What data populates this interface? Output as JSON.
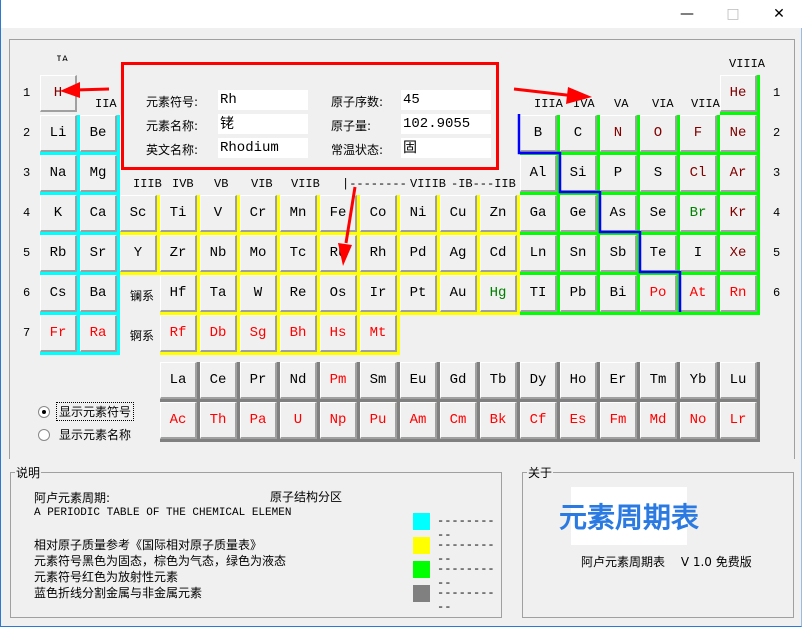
{
  "window": {
    "controls": [
      "minimize",
      "maximize",
      "close"
    ]
  },
  "info": {
    "symbol_label": "元素符号:",
    "symbol": "Rh",
    "name_label": "元素名称:",
    "name": "铑",
    "english_label": "英文名称:",
    "english": "Rhodium",
    "number_label": "原子序数:",
    "number": "45",
    "mass_label": "原子量:",
    "mass": "102.9055",
    "state_label": "常温状态:",
    "state": "固"
  },
  "colors": {
    "solid": "#000000",
    "gas": "#800000",
    "liquid": "#008000",
    "radioactive": "#ff0000",
    "s": "#00ffff",
    "d": "#ffff00",
    "p": "#00ff00",
    "f": "#808080",
    "boundary": "#0000ff",
    "highlight": "#ff0000"
  },
  "group_labels": {
    "IA": "IA",
    "IIA": "IIA",
    "IIIA": "IIIA",
    "IVA": "IVA",
    "VA": "VA",
    "VIA": "VIA",
    "VIIA": "VIIA",
    "VIIIA": "VIIIA",
    "IIIB": "IIIB",
    "IVB": "IVB",
    "VB": "VB",
    "VIB": "VIB",
    "VIIB": "VIIB",
    "VIII_start": "|--------",
    "VIIIB": "VIIIB",
    "IB_IIB": "-IB---IIB"
  },
  "periods": [
    "1",
    "2",
    "3",
    "4",
    "5",
    "6",
    "7"
  ],
  "series_labels": {
    "lanthanide": "镧系",
    "actinide": "锕系"
  },
  "elements": [
    [
      "H",
      1,
      1,
      "gas",
      "none"
    ],
    [
      "He",
      1,
      18,
      "gas",
      "p"
    ],
    [
      "Li",
      2,
      1,
      "solid",
      "s"
    ],
    [
      "Be",
      2,
      2,
      "solid",
      "s"
    ],
    [
      "B",
      2,
      13,
      "solid",
      "p"
    ],
    [
      "C",
      2,
      14,
      "solid",
      "p"
    ],
    [
      "N",
      2,
      15,
      "gas",
      "p"
    ],
    [
      "O",
      2,
      16,
      "gas",
      "p"
    ],
    [
      "F",
      2,
      17,
      "gas",
      "p"
    ],
    [
      "Ne",
      2,
      18,
      "gas",
      "p"
    ],
    [
      "Na",
      3,
      1,
      "solid",
      "s"
    ],
    [
      "Mg",
      3,
      2,
      "solid",
      "s"
    ],
    [
      "Al",
      3,
      13,
      "solid",
      "p"
    ],
    [
      "Si",
      3,
      14,
      "solid",
      "p"
    ],
    [
      "P",
      3,
      15,
      "solid",
      "p"
    ],
    [
      "S",
      3,
      16,
      "solid",
      "p"
    ],
    [
      "Cl",
      3,
      17,
      "gas",
      "p"
    ],
    [
      "Ar",
      3,
      18,
      "gas",
      "p"
    ],
    [
      "K",
      4,
      1,
      "solid",
      "s"
    ],
    [
      "Ca",
      4,
      2,
      "solid",
      "s"
    ],
    [
      "Sc",
      4,
      3,
      "solid",
      "d"
    ],
    [
      "Ti",
      4,
      4,
      "solid",
      "d"
    ],
    [
      "V",
      4,
      5,
      "solid",
      "d"
    ],
    [
      "Cr",
      4,
      6,
      "solid",
      "d"
    ],
    [
      "Mn",
      4,
      7,
      "solid",
      "d"
    ],
    [
      "Fe",
      4,
      8,
      "solid",
      "d"
    ],
    [
      "Co",
      4,
      9,
      "solid",
      "d"
    ],
    [
      "Ni",
      4,
      10,
      "solid",
      "d"
    ],
    [
      "Cu",
      4,
      11,
      "solid",
      "d"
    ],
    [
      "Zn",
      4,
      12,
      "solid",
      "d"
    ],
    [
      "Ga",
      4,
      13,
      "solid",
      "p"
    ],
    [
      "Ge",
      4,
      14,
      "solid",
      "p"
    ],
    [
      "As",
      4,
      15,
      "solid",
      "p"
    ],
    [
      "Se",
      4,
      16,
      "solid",
      "p"
    ],
    [
      "Br",
      4,
      17,
      "liquid",
      "p"
    ],
    [
      "Kr",
      4,
      18,
      "gas",
      "p"
    ],
    [
      "Rb",
      5,
      1,
      "solid",
      "s"
    ],
    [
      "Sr",
      5,
      2,
      "solid",
      "s"
    ],
    [
      "Y",
      5,
      3,
      "solid",
      "d"
    ],
    [
      "Zr",
      5,
      4,
      "solid",
      "d"
    ],
    [
      "Nb",
      5,
      5,
      "solid",
      "d"
    ],
    [
      "Mo",
      5,
      6,
      "solid",
      "d"
    ],
    [
      "Tc",
      5,
      7,
      "solid",
      "d"
    ],
    [
      "Ru",
      5,
      8,
      "solid",
      "d"
    ],
    [
      "Rh",
      5,
      9,
      "solid",
      "d"
    ],
    [
      "Pd",
      5,
      10,
      "solid",
      "d"
    ],
    [
      "Ag",
      5,
      11,
      "solid",
      "d"
    ],
    [
      "Cd",
      5,
      12,
      "solid",
      "d"
    ],
    [
      "Ln",
      5,
      13,
      "solid",
      "p"
    ],
    [
      "Sn",
      5,
      14,
      "solid",
      "p"
    ],
    [
      "Sb",
      5,
      15,
      "solid",
      "p"
    ],
    [
      "Te",
      5,
      16,
      "solid",
      "p"
    ],
    [
      "I",
      5,
      17,
      "solid",
      "p"
    ],
    [
      "Xe",
      5,
      18,
      "gas",
      "p"
    ],
    [
      "Cs",
      6,
      1,
      "solid",
      "s"
    ],
    [
      "Ba",
      6,
      2,
      "solid",
      "s"
    ],
    [
      "Hf",
      6,
      4,
      "solid",
      "d"
    ],
    [
      "Ta",
      6,
      5,
      "solid",
      "d"
    ],
    [
      "W",
      6,
      6,
      "solid",
      "d"
    ],
    [
      "Re",
      6,
      7,
      "solid",
      "d"
    ],
    [
      "Os",
      6,
      8,
      "solid",
      "d"
    ],
    [
      "Ir",
      6,
      9,
      "solid",
      "d"
    ],
    [
      "Pt",
      6,
      10,
      "solid",
      "d"
    ],
    [
      "Au",
      6,
      11,
      "solid",
      "d"
    ],
    [
      "Hg",
      6,
      12,
      "liquid",
      "d"
    ],
    [
      "TI",
      6,
      13,
      "solid",
      "p"
    ],
    [
      "Pb",
      6,
      14,
      "solid",
      "p"
    ],
    [
      "Bi",
      6,
      15,
      "solid",
      "p"
    ],
    [
      "Po",
      6,
      16,
      "radioactive",
      "p"
    ],
    [
      "At",
      6,
      17,
      "radioactive",
      "p"
    ],
    [
      "Rn",
      6,
      18,
      "radioactive",
      "p"
    ],
    [
      "Fr",
      7,
      1,
      "radioactive",
      "s"
    ],
    [
      "Ra",
      7,
      2,
      "radioactive",
      "s"
    ],
    [
      "Rf",
      7,
      4,
      "radioactive",
      "d"
    ],
    [
      "Db",
      7,
      5,
      "radioactive",
      "d"
    ],
    [
      "Sg",
      7,
      6,
      "radioactive",
      "d"
    ],
    [
      "Bh",
      7,
      7,
      "radioactive",
      "d"
    ],
    [
      "Hs",
      7,
      8,
      "radioactive",
      "d"
    ],
    [
      "Mt",
      7,
      9,
      "radioactive",
      "d"
    ]
  ],
  "lanthanides": [
    [
      "La",
      "solid"
    ],
    [
      "Ce",
      "solid"
    ],
    [
      "Pr",
      "solid"
    ],
    [
      "Nd",
      "solid"
    ],
    [
      "Pm",
      "radioactive"
    ],
    [
      "Sm",
      "solid"
    ],
    [
      "Eu",
      "solid"
    ],
    [
      "Gd",
      "solid"
    ],
    [
      "Tb",
      "solid"
    ],
    [
      "Dy",
      "solid"
    ],
    [
      "Ho",
      "solid"
    ],
    [
      "Er",
      "solid"
    ],
    [
      "Tm",
      "solid"
    ],
    [
      "Yb",
      "solid"
    ],
    [
      "Lu",
      "solid"
    ]
  ],
  "actinides": [
    [
      "Ac",
      "radioactive"
    ],
    [
      "Th",
      "radioactive"
    ],
    [
      "Pa",
      "radioactive"
    ],
    [
      "U",
      "radioactive"
    ],
    [
      "Np",
      "radioactive"
    ],
    [
      "Pu",
      "radioactive"
    ],
    [
      "Am",
      "radioactive"
    ],
    [
      "Cm",
      "radioactive"
    ],
    [
      "Bk",
      "radioactive"
    ],
    [
      "Cf",
      "radioactive"
    ],
    [
      "Es",
      "radioactive"
    ],
    [
      "Fm",
      "radioactive"
    ],
    [
      "Md",
      "radioactive"
    ],
    [
      "No",
      "radioactive"
    ],
    [
      "Lr",
      "radioactive"
    ]
  ],
  "display_options": [
    {
      "label": "显示元素符号",
      "selected": true
    },
    {
      "label": "显示元素名称",
      "selected": false
    }
  ],
  "notes": {
    "title": "说明",
    "line1": "阿卢元素周期:",
    "line2": "A PERIODIC TABLE OF THE CHEMICAL ELEMEN",
    "line3": "相对原子质量参考《国际相对原子质量表》",
    "line4": "元素符号黑色为固态，棕色为气态，绿色为液态",
    "line5": "元素符号红色为放射性元素",
    "line6": "蓝色折线分割金属与非金属元素",
    "zones_title": "原子结构分区",
    "zones": [
      {
        "color": "#00ffff",
        "label": "----------"
      },
      {
        "color": "#ffff00",
        "label": "----------"
      },
      {
        "color": "#00ff00",
        "label": "----------"
      },
      {
        "color": "#808080",
        "label": "----------"
      }
    ]
  },
  "about": {
    "title": "关于",
    "logo": "元素周期表",
    "version_text": "阿卢元素周期表　 V 1.0 免费版"
  }
}
